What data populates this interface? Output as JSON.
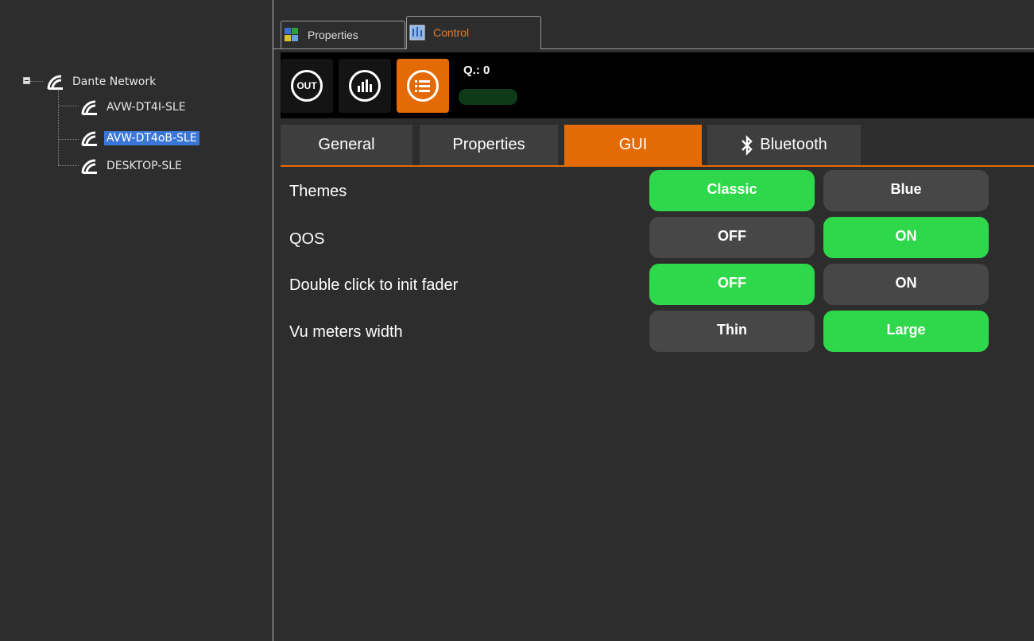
{
  "tree": {
    "root": {
      "label": "Dante Network"
    },
    "children": [
      {
        "label": "AVW-DT4I-SLE",
        "selected": false
      },
      {
        "label": "AVW-DT4oB-SLE",
        "selected": true
      },
      {
        "label": "DESKTOP-SLE",
        "selected": false
      }
    ]
  },
  "window_tabs": [
    {
      "label": "Properties",
      "icon": "properties-icon",
      "active": false
    },
    {
      "label": "Control",
      "icon": "control-icon",
      "active": true
    }
  ],
  "toolbar": {
    "buttons": [
      {
        "name": "out",
        "label": "OUT",
        "icon": "out-icon",
        "active": false
      },
      {
        "name": "meter",
        "label": "",
        "icon": "bar-meter-icon",
        "active": false
      },
      {
        "name": "list",
        "label": "",
        "icon": "list-icon",
        "active": true
      }
    ],
    "q_label": "Q.: 0"
  },
  "gui_tabs": [
    {
      "label": "General",
      "active": false
    },
    {
      "label": "Properties",
      "active": false
    },
    {
      "label": "GUI",
      "active": true
    },
    {
      "label": "Bluetooth",
      "icon": "bluetooth-icon",
      "active": false
    }
  ],
  "settings": [
    {
      "label": "Themes",
      "options": [
        "Classic",
        "Blue"
      ],
      "selected": 0
    },
    {
      "label": "QOS",
      "options": [
        "OFF",
        "ON"
      ],
      "selected": 1
    },
    {
      "label": "Double click to init fader",
      "options": [
        "OFF",
        "ON"
      ],
      "selected": 0
    },
    {
      "label": "Vu meters width",
      "options": [
        "Thin",
        "Large"
      ],
      "selected": 1
    }
  ],
  "colors": {
    "accent": "#e46a05",
    "selected_option": "#2fd84a",
    "unselected_option": "#474747",
    "tree_selection": "#3a76d6",
    "background": "#2d2d2d"
  }
}
